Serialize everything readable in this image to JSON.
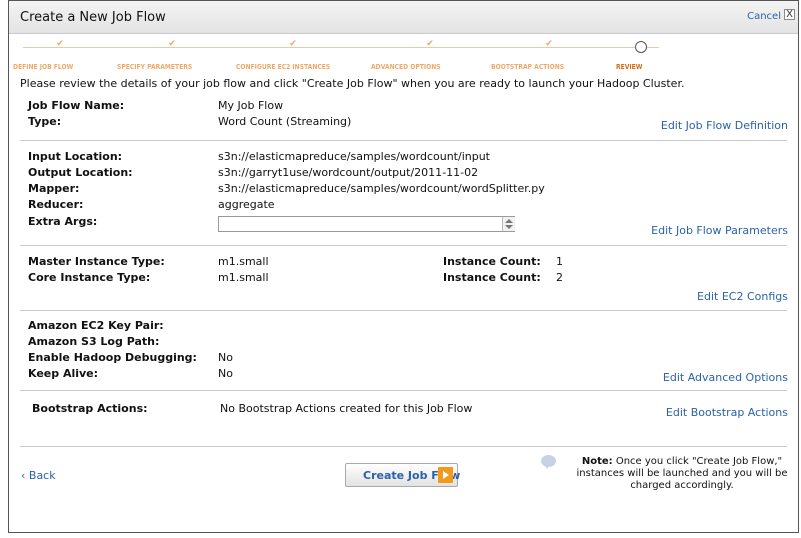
{
  "window": {
    "title": "Create a New Job Flow",
    "cancel_label": "Cancel",
    "close_glyph": "X"
  },
  "wizard": {
    "steps": [
      {
        "label": "DEFINE JOB FLOW",
        "done": true
      },
      {
        "label": "SPECIFY PARAMETERS",
        "done": true
      },
      {
        "label": "CONFIGURE EC2 INSTANCES",
        "done": true
      },
      {
        "label": "ADVANCED OPTIONS",
        "done": true
      },
      {
        "label": "BOOTSTRAP ACTIONS",
        "done": true
      },
      {
        "label": "REVIEW",
        "done": false,
        "current": true
      }
    ],
    "check_glyph": "✔"
  },
  "intro": "Please review the details of your job flow and click \"Create Job Flow\" when you are ready to launch your Hadoop Cluster.",
  "job_flow": {
    "name_label": "Job Flow Name:",
    "name_value": "My Job Flow",
    "type_label": "Type:",
    "type_value": "Word Count (Streaming)",
    "edit_link": "Edit Job Flow Definition"
  },
  "parameters": {
    "input_label": "Input Location:",
    "input_value": "s3n://elasticmapreduce/samples/wordcount/input",
    "output_label": "Output Location:",
    "output_value": "s3n://garryt1use/wordcount/output/2011-11-02",
    "mapper_label": "Mapper:",
    "mapper_value": "s3n://elasticmapreduce/samples/wordcount/wordSplitter.py",
    "reducer_label": "Reducer:",
    "reducer_value": "aggregate",
    "extra_args_label": "Extra Args:",
    "extra_args_value": "",
    "edit_link": "Edit Job Flow Parameters"
  },
  "ec2": {
    "master_type_label": "Master Instance Type:",
    "master_type_value": "m1.small",
    "master_count_label": "Instance Count:",
    "master_count_value": "1",
    "core_type_label": "Core Instance Type:",
    "core_type_value": "m1.small",
    "core_count_label": "Instance Count:",
    "core_count_value": "2",
    "edit_link": "Edit EC2 Configs"
  },
  "advanced": {
    "key_pair_label": "Amazon EC2 Key Pair:",
    "key_pair_value": "",
    "log_path_label": "Amazon S3 Log Path:",
    "log_path_value": "",
    "debugging_label": "Enable Hadoop Debugging:",
    "debugging_value": "No",
    "keep_alive_label": "Keep Alive:",
    "keep_alive_value": "No",
    "edit_link": "Edit Advanced Options"
  },
  "bootstrap": {
    "label": "Bootstrap Actions:",
    "value": "No Bootstrap Actions created for this Job Flow",
    "edit_link": "Edit Bootstrap Actions"
  },
  "footer": {
    "back_label": "‹ Back",
    "create_label": "Create Job Flow",
    "note_title": "Note:",
    "note_text": "Once you click \"Create Job Flow,\" instances will be launched and you will be charged accordingly."
  },
  "colors": {
    "link": "#2a62a8",
    "step_done": "#f0a868",
    "step_current": "#d86c12",
    "button_arrow": "#f29a1b"
  },
  "icons": {
    "close": "close-icon",
    "step_check": "check-icon",
    "step_current": "circle-icon",
    "spinner": "spinner-icon",
    "button_arrow": "arrow-right-icon",
    "note": "speech-bubble-icon"
  }
}
